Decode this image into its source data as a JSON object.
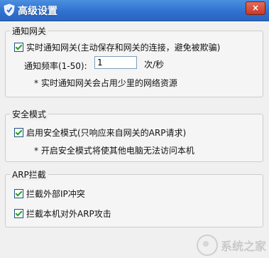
{
  "window": {
    "title": "高级设置",
    "close_label": "×"
  },
  "notify_group": {
    "title": "通知网关",
    "realtime_checkbox": {
      "label": "实时通知网关(主动保存和网关的连接，避免被欺骗)",
      "checked": true
    },
    "freq_label": "通知频率(1-50):",
    "freq_value": "1",
    "freq_unit": "次/秒",
    "note": "* 实时通知网关会占用少里的网络资源"
  },
  "safe_group": {
    "title": "安全模式",
    "safe_checkbox": {
      "label": "启用安全模式(只响应来自网关的ARP请求)",
      "checked": true
    },
    "note": "* 开启安全模式将使其他电脑无法访问本机"
  },
  "arp_group": {
    "title": "ARP拦截",
    "block_external_ip": {
      "label": "拦截外部IP冲突",
      "checked": true
    },
    "block_outbound_arp": {
      "label": "拦截本机对外ARP攻击",
      "checked": true
    }
  },
  "watermark": {
    "text": "系统之家"
  },
  "colors": {
    "titlebar": "#2f6fce",
    "check": "#21a121",
    "close": "#c73a28"
  }
}
